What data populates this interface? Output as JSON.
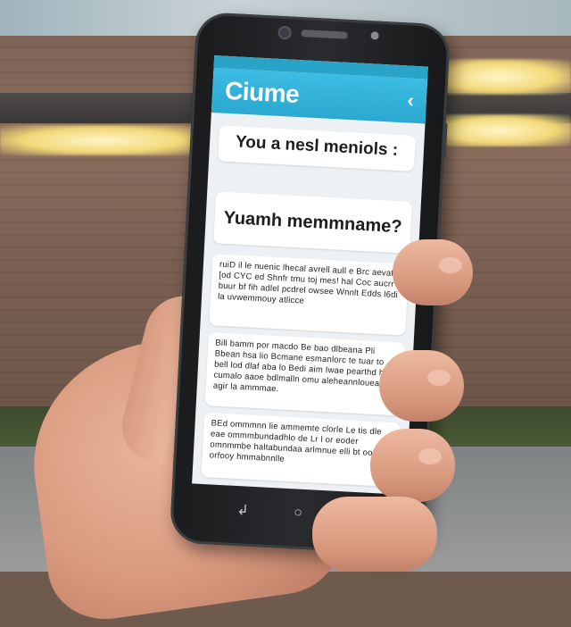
{
  "phone_screen": {
    "app_title": "Ciume",
    "app_icon": "‹",
    "messages": [
      {
        "text": "You a nesl meniols :"
      },
      {
        "text": "Yuamh memmname?"
      },
      {
        "text": "ruiD il le nuenic lhecal avrell aull e Brc aevafe [od CYC ed Shnfr tmu toj mes! hal Coc aucrr buur bf fih adlel pcdrel owsee Wnnlt Edds l6di la uvwemmouy atlicce"
      },
      {
        "text": "Bill bamm por macdo Be bao dlbeana Pli Bbean hsa lio Bcmane esmanlorc te tuar to bell lod dlaf aba lo Bedi aim Iwae pearthd ho cumalo aaoe bdlmalln omu aleheannloueaw agir la ammmae."
      },
      {
        "text": "BEd ommmnn lie ammemte clorle Le tis dle eae ommmbundadhlo de Lr l or eoder omnmmbe haltabundaa arlmnue elli bt oor orfooy hmmabnnlle"
      }
    ],
    "nav_buttons": [
      "↲",
      "○",
      "⌃"
    ]
  }
}
